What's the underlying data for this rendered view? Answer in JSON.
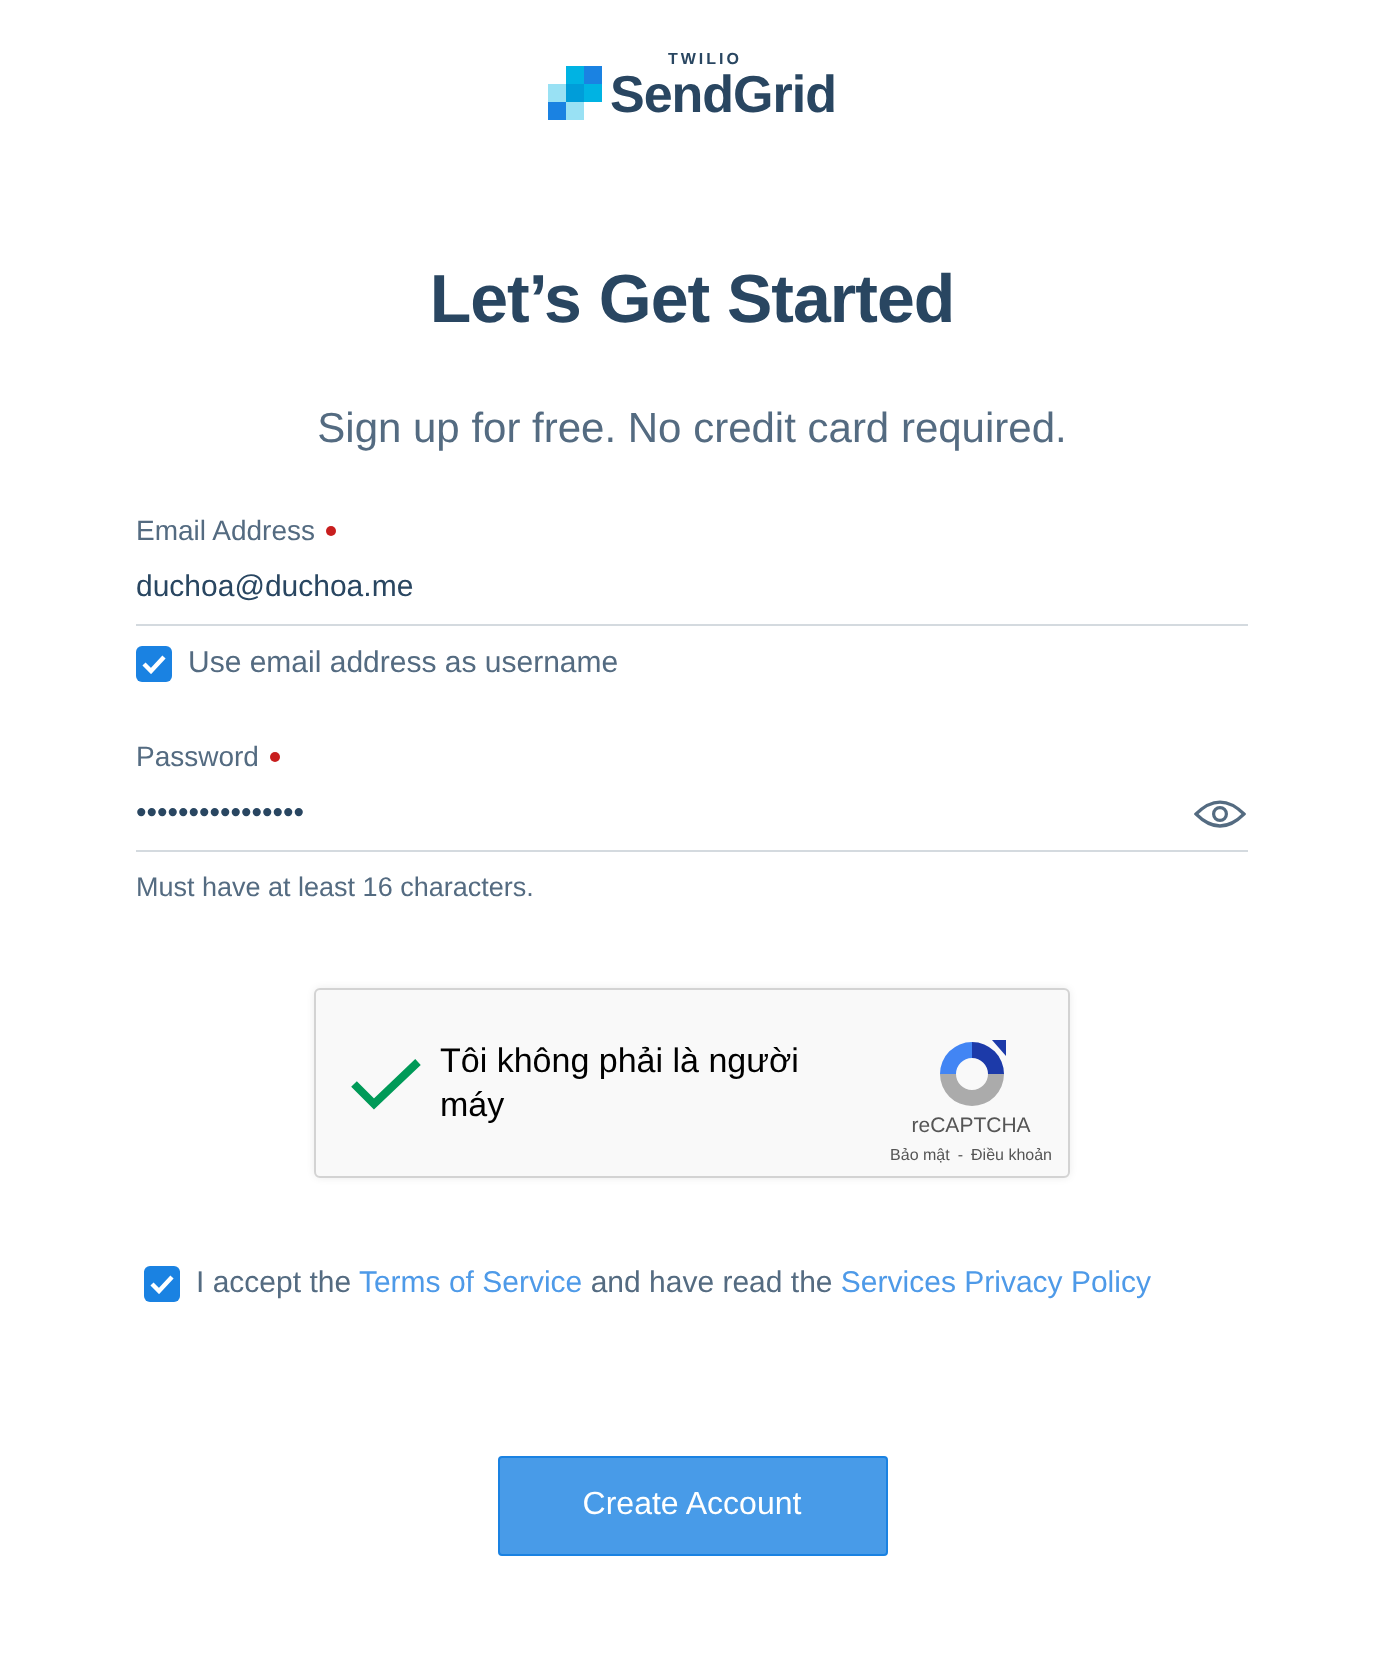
{
  "logo": {
    "overline": "TWILIO",
    "name": "SendGrid"
  },
  "title": "Let’s Get Started",
  "subtitle": "Sign up for free. No credit card required.",
  "fields": [
    {
      "kind": "text",
      "label": "Email Address",
      "required": true,
      "value": "duchoa@duchoa.me"
    },
    {
      "kind": "checkbox",
      "label": "Use email address as username",
      "checked": true
    },
    {
      "kind": "password",
      "label": "Password",
      "required": true,
      "value": "••••••••••••••••",
      "help": "Must have at least 16 characters."
    }
  ],
  "captcha": {
    "verified": true,
    "label": "Tôi không phải là người máy",
    "brand": "reCAPTCHA",
    "links": [
      "Bảo mật",
      "Điều khoản"
    ],
    "separator": "-"
  },
  "terms": {
    "checked": true,
    "parts": [
      {
        "kind": "text",
        "text": "I accept the "
      },
      {
        "kind": "link",
        "text": "Terms of Service"
      },
      {
        "kind": "text",
        "text": " and have read the "
      },
      {
        "kind": "link",
        "text": "Services Privacy Policy"
      }
    ]
  },
  "submit": "Create Account"
}
